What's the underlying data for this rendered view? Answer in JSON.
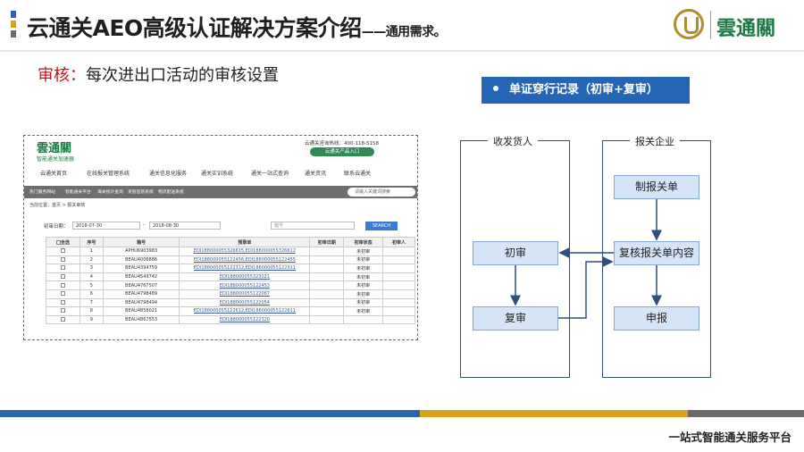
{
  "title": {
    "main": "云通关AEO高级认证解决方案介绍",
    "sub": "——通用需求。"
  },
  "brand": {
    "logo_text": "雲通關"
  },
  "subtitle": {
    "label": "审核：",
    "text": "每次进出口活动的审核设置"
  },
  "screenshot": {
    "logo": "雲通關",
    "logo_sub": "智能通关加速器",
    "hotline": "云通关咨询热线：400-118-5158",
    "entry_button": "云通关产品入口",
    "nav": [
      "云通关首页",
      "在线报关管理系统",
      "通关信息化服务",
      "通关实训系统",
      "通关一站式查询",
      "通关资讯",
      "联系云通关"
    ],
    "subnav": [
      "热门服务网站",
      "智能通关平台",
      "海关统计查询",
      "货管监管系统",
      "物流配送系统"
    ],
    "search_placeholder": "请输入关键词搜索",
    "breadcrumb": "当前位置：首页 > 报关审核",
    "filter_label": "初审日期：",
    "date_from": "2018-07-30",
    "date_to": "2018-08-30",
    "no_placeholder": "箱号",
    "search_button": "SEARCH",
    "columns": [
      "全选",
      "序号",
      "箱号",
      "预录单",
      "初审日期",
      "初审状态",
      "初审人"
    ],
    "rows": [
      [
        "1",
        "APHU6903983",
        "EDI188000055326615,EDI188000055326612",
        "",
        "未初审",
        ""
      ],
      [
        "2",
        "BEAU4006886",
        "EDI188000055122456,EDI188000055122455",
        "",
        "未初审",
        ""
      ],
      [
        "3",
        "BEAU4394759",
        "EDI188000055122312,EDI188000055122311",
        "",
        "未初审",
        ""
      ],
      [
        "4",
        "BEAU4549742",
        "EDI188000055323021",
        "",
        "未初审",
        ""
      ],
      [
        "5",
        "BEAU4767507",
        "EDI188000055122453",
        "",
        "未初审",
        ""
      ],
      [
        "6",
        "BEAU4798489",
        "EDI188000055122067",
        "",
        "未初审",
        ""
      ],
      [
        "7",
        "BEAU4798494",
        "EDI188000055122054",
        "",
        "未初审",
        ""
      ],
      [
        "8",
        "BEAU4858021",
        "EDI188000055122612,EDI188000055122611",
        "",
        "未初审",
        ""
      ],
      [
        "9",
        "BEAU4867553",
        "EDI188000055122320",
        "",
        "",
        ""
      ]
    ]
  },
  "flow": {
    "label": "单证穿行记录（初审+复审）",
    "lane_left_title": "收发货人",
    "lane_right_title": "报关企业",
    "boxes": {
      "prepare": "制报关单",
      "first_review": "初审",
      "recheck": "复核报关单内容",
      "second_review": "复审",
      "declare": "申报"
    }
  },
  "footer": {
    "text": "一站式智能通关服务平台"
  },
  "colors": {
    "accent_blue": "#2566b4",
    "lane_border": "#2f4e7c",
    "box_fill": "#d6e4f7",
    "brand_green": "#1a7a45",
    "highlight_red": "#c0141e",
    "stripe_blue": "#2b63b0",
    "stripe_gold": "#d9a21b",
    "stripe_grey": "#6b6b6b"
  }
}
